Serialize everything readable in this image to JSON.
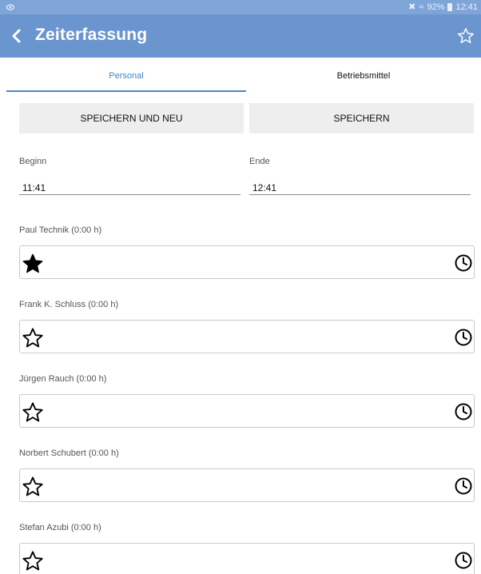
{
  "status_bar": {
    "battery": "92%",
    "time": "12:41"
  },
  "app_bar": {
    "title": "Zeiterfassung"
  },
  "tabs": [
    {
      "label": "Personal",
      "active": true
    },
    {
      "label": "Betriebsmittel",
      "active": false
    }
  ],
  "actions": {
    "save_and_new": "SPEICHERN UND NEU",
    "save": "SPEICHERN"
  },
  "time_fields": {
    "begin": {
      "label": "Beginn",
      "value": "11:41"
    },
    "end": {
      "label": "Ende",
      "value": "12:41"
    }
  },
  "persons": [
    {
      "label": "Paul Technik (0:00 h)",
      "favorite": true
    },
    {
      "label": "Frank K. Schluss (0:00 h)",
      "favorite": false
    },
    {
      "label": "Jürgen Rauch (0:00 h)",
      "favorite": false
    },
    {
      "label": "Norbert Schubert (0:00 h)",
      "favorite": false
    },
    {
      "label": "Stefan Azubi (0:00 h)",
      "favorite": false
    }
  ],
  "colors": {
    "app_bar": "#6b95cf",
    "status_bar": "#7fa5d8",
    "tab_active": "#3f86c7"
  }
}
